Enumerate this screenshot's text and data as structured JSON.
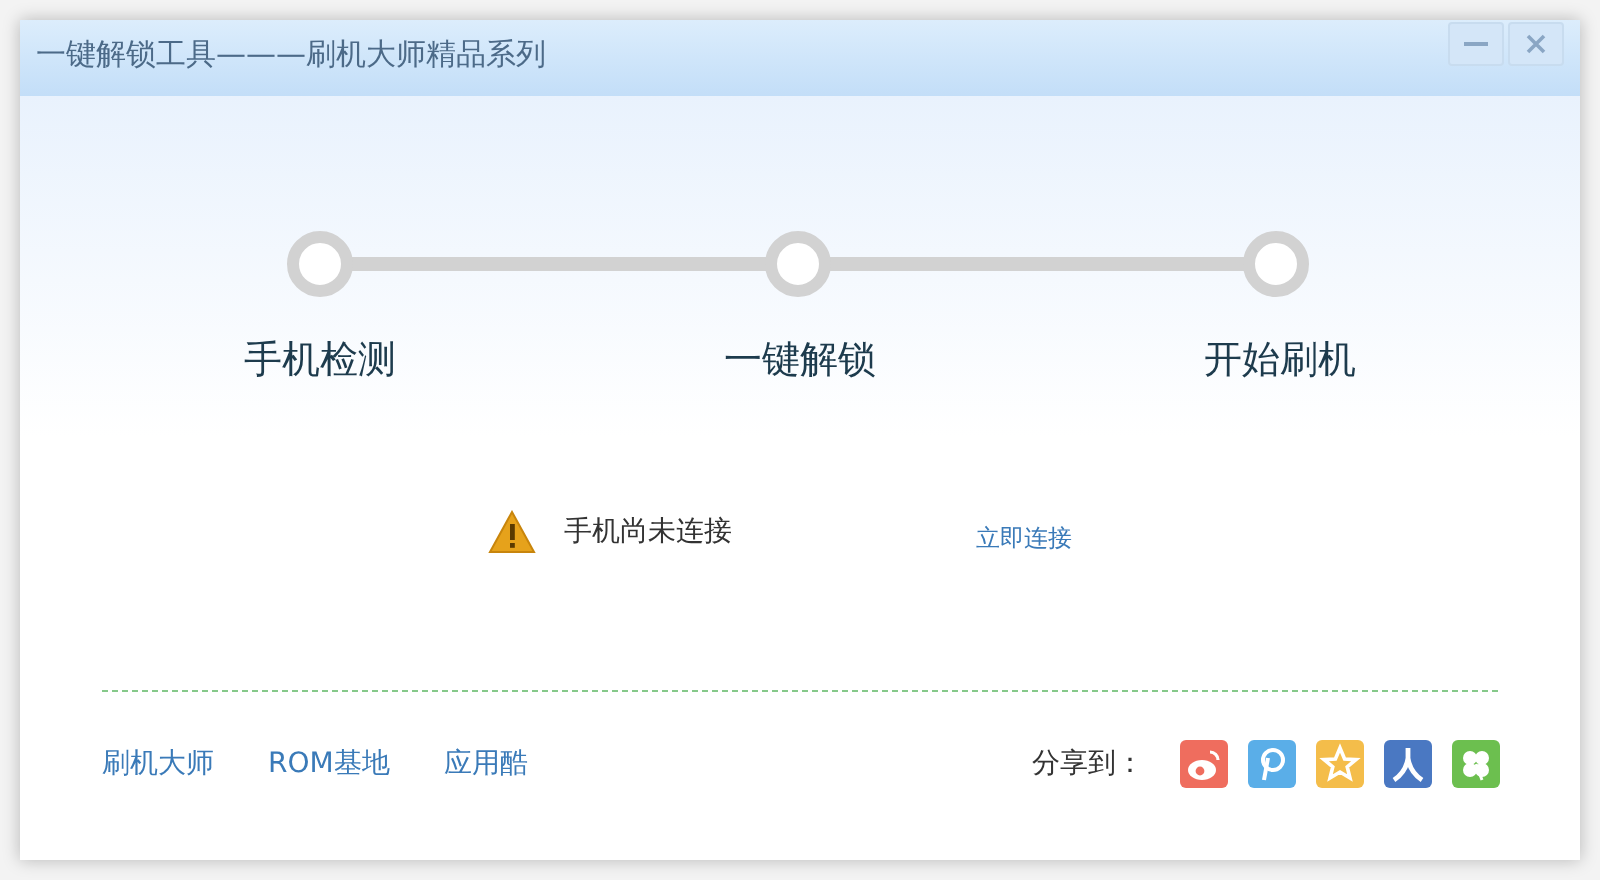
{
  "window": {
    "title": "一键解锁工具———刷机大师精品系列"
  },
  "steps": [
    {
      "label": "手机检测"
    },
    {
      "label": "一键解锁"
    },
    {
      "label": "开始刷机"
    }
  ],
  "status": {
    "message": "手机尚未连接",
    "action": "立即连接"
  },
  "footer": {
    "links": [
      "刷机大师",
      "ROM基地",
      "应用酷"
    ],
    "share_label": "分享到："
  }
}
